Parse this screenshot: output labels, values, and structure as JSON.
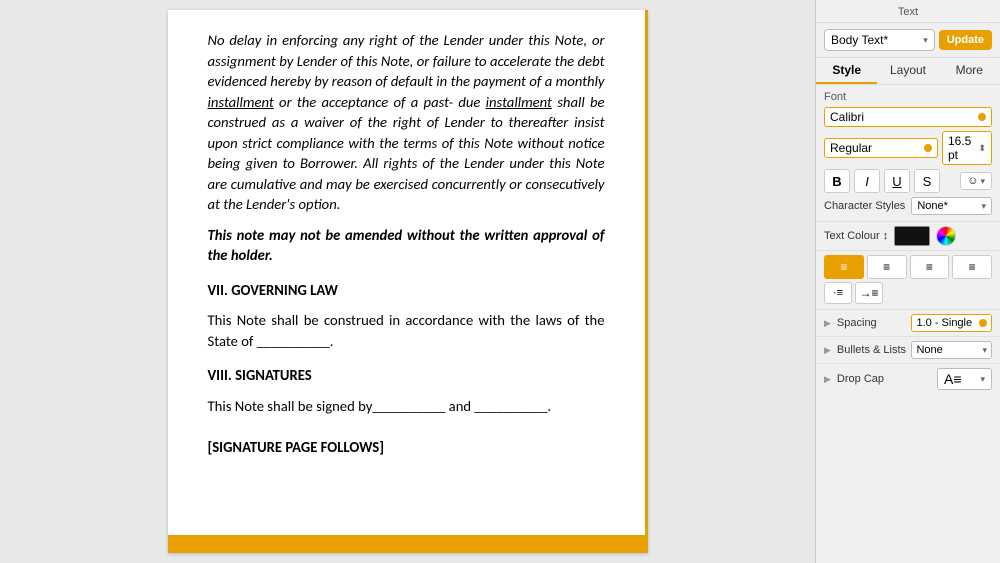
{
  "panel": {
    "title": "Text",
    "tabs": [
      "Style",
      "Layout",
      "More"
    ],
    "active_tab": "Style",
    "style_selector": {
      "value": "Body Text*",
      "chevron": "▾"
    },
    "update_button": "Update",
    "font": {
      "label": "Font",
      "family": "Calibri",
      "weight": "Regular",
      "size": "16.5 pt",
      "bold": "B",
      "italic": "I",
      "underline": "U",
      "strikethrough": "S"
    },
    "character_styles": {
      "label": "Character Styles",
      "value": "None*"
    },
    "text_color": {
      "label": "Text Colour ↕"
    },
    "spacing": {
      "label": "Spacing",
      "value": "1.0 - Single"
    },
    "bullets": {
      "label": "Bullets & Lists",
      "value": "None"
    },
    "drop_cap": {
      "label": "Drop Cap"
    }
  },
  "document": {
    "paragraphs": [
      "No delay in enforcing any right of the Lender under this Note, or assignment by Lender of this Note, or failure to accelerate the debt evidenced hereby by reason of default in the payment of a monthly installment or the acceptance of a past- due installment shall be construed as a waiver of the right of Lender to thereafter insist upon strict compliance with the terms of this Note without notice being given to Borrower. All rights of the Lender under this Note are cumulative and may be exercised concurrently or consecutively at the Lender's option."
    ],
    "bold_italic_text": "This note may not be amended without the written approval of the holder.",
    "section7": {
      "heading": "VII. GOVERNING LAW",
      "body": "This Note shall be construed in accordance with the laws of the State of __________."
    },
    "section8": {
      "heading": "VIII. SIGNATURES",
      "body": "This Note shall be signed by __________ and __________."
    },
    "signature_page": "[SIGNATURE PAGE FOLLOWS]"
  }
}
